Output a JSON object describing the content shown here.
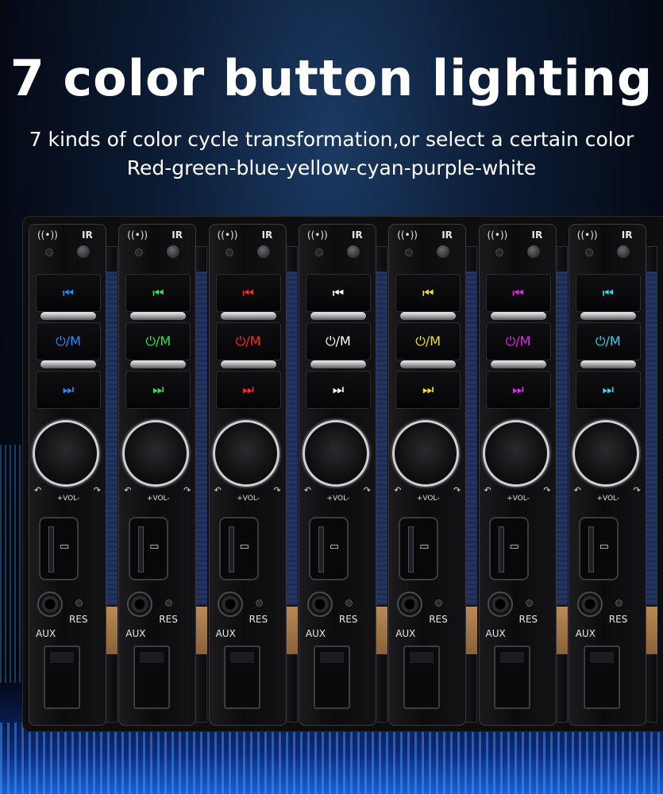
{
  "heading": {
    "title": "7 color button lighting",
    "subtitle_line1": "7 kinds of color cycle transformation,or select a certain color",
    "subtitle_line2": "Red-green-blue-yellow-cyan-purple-white"
  },
  "panel_labels": {
    "prev_glyph": "⏮",
    "power_mode": "⏻/M",
    "next_glyph": "⏭",
    "vol": "+VOL-",
    "aux": "AUX",
    "res": "RES",
    "ir": "IR",
    "signal_icon": "signal-icon"
  },
  "units": [
    {
      "color_name": "blue",
      "color": "#1f8fff"
    },
    {
      "color_name": "green",
      "color": "#2ee84a"
    },
    {
      "color_name": "red",
      "color": "#ff2a2a"
    },
    {
      "color_name": "white",
      "color": "#ffffff"
    },
    {
      "color_name": "yellow",
      "color": "#f4e21c"
    },
    {
      "color_name": "purple",
      "color": "#e02ae8"
    },
    {
      "color_name": "cyan",
      "color": "#34d6ee"
    }
  ]
}
